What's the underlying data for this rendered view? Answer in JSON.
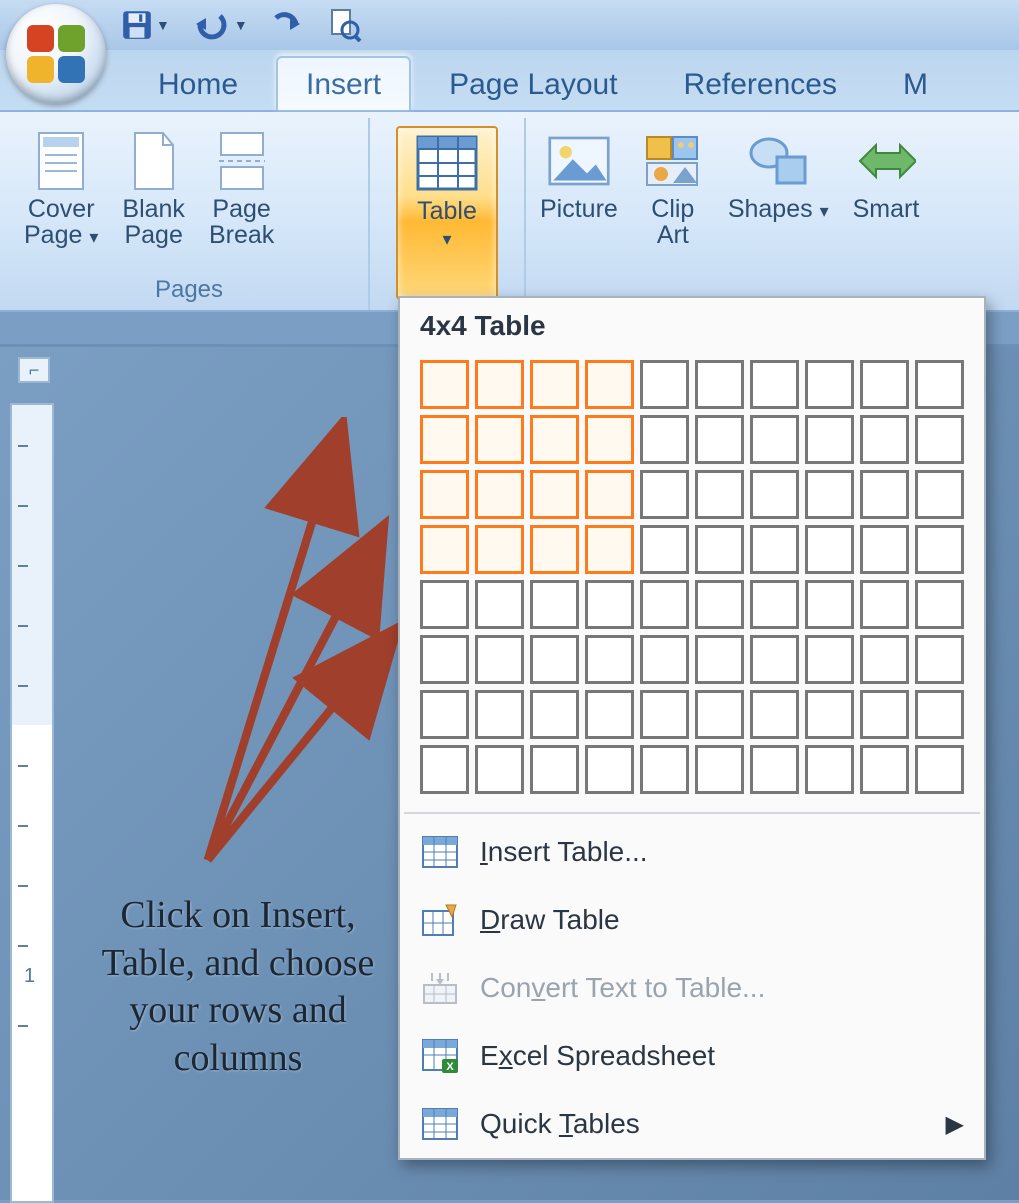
{
  "qat": {
    "save": "save-icon",
    "undo": "undo-icon",
    "redo": "redo-icon",
    "preview": "print-preview-icon"
  },
  "tabs": [
    "Home",
    "Insert",
    "Page Layout",
    "References",
    "M"
  ],
  "active_tab_index": 1,
  "ribbon": {
    "groups": [
      {
        "caption": "Pages",
        "items": [
          {
            "label_line1": "Cover",
            "label_line2": "Page",
            "dropdown": true,
            "icon": "cover-page-icon"
          },
          {
            "label_line1": "Blank",
            "label_line2": "Page",
            "dropdown": false,
            "icon": "blank-page-icon"
          },
          {
            "label_line1": "Page",
            "label_line2": "Break",
            "dropdown": false,
            "icon": "page-break-icon"
          }
        ]
      },
      {
        "caption": "",
        "items": [
          {
            "label_line1": "Table",
            "label_line2": "",
            "dropdown": true,
            "icon": "table-icon",
            "highlighted": true
          }
        ]
      },
      {
        "caption": "",
        "items": [
          {
            "label_line1": "Picture",
            "icon": "picture-icon"
          },
          {
            "label_line1": "Clip",
            "label_line2": "Art",
            "icon": "clip-art-icon"
          },
          {
            "label_line1": "Shapes",
            "dropdown": true,
            "icon": "shapes-icon"
          },
          {
            "label_line1": "Smart",
            "icon": "smartart-icon"
          }
        ]
      }
    ]
  },
  "dropdown": {
    "title": "4x4 Table",
    "grid_cols": 10,
    "grid_rows": 8,
    "selected_cols": 4,
    "selected_rows": 4,
    "items": [
      {
        "label_pre": "",
        "u": "I",
        "label_post": "nsert Table...",
        "icon": "insert-table-icon",
        "disabled": false,
        "submenu": false
      },
      {
        "label_pre": "",
        "u": "D",
        "label_post": "raw Table",
        "icon": "draw-table-icon",
        "disabled": false,
        "submenu": false
      },
      {
        "label_pre": "Con",
        "u": "v",
        "label_post": "ert Text to Table...",
        "icon": "convert-text-icon",
        "disabled": true,
        "submenu": false
      },
      {
        "label_pre": "E",
        "u": "x",
        "label_post": "cel Spreadsheet",
        "icon": "excel-icon",
        "disabled": false,
        "submenu": false
      },
      {
        "label_pre": "Quick ",
        "u": "T",
        "label_post": "ables",
        "icon": "quick-tables-icon",
        "disabled": false,
        "submenu": true
      }
    ]
  },
  "annotation_text": "Click on Insert, Table, and choose your rows and columns",
  "colors": {
    "ribbon_blue": "#c5ddf3",
    "accent_orange": "#ff7a1a",
    "highlight_gold": "#ffb934",
    "arrow": "#a0402c"
  }
}
